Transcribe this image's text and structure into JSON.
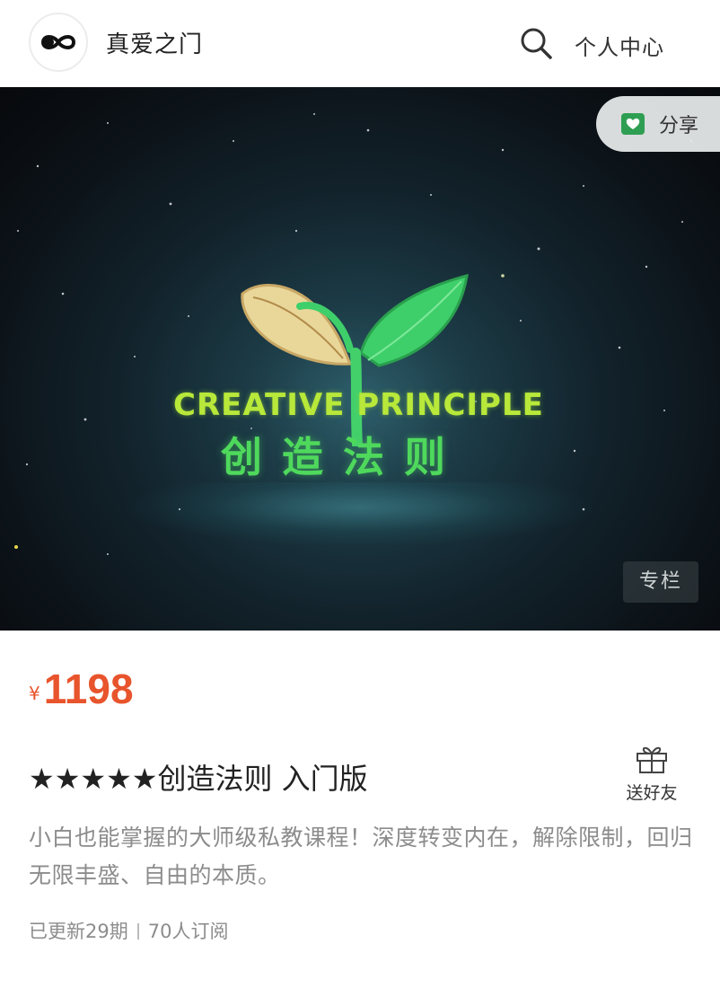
{
  "header": {
    "shop_name": "真爱之门",
    "personal_center": "个人中心",
    "logo_icon": "infinity-icon",
    "search_icon": "search-icon"
  },
  "banner": {
    "share_label": "分享",
    "share_icon": "wechat-share-icon",
    "tag": "专栏",
    "title_en": "CREATIVE PRINCIPLE",
    "title_cn": "创造法则"
  },
  "product": {
    "currency": "¥",
    "price": "1198",
    "title": "★★★★★创造法则 入门版",
    "gift_label": "送好友",
    "gift_icon": "gift-icon",
    "description": "小白也能掌握的大师级私教课程！深度转变内在，解除限制，回归无限丰盛、自由的本质。",
    "updated": "已更新29期",
    "subscribers": "70人订阅"
  },
  "colors": {
    "accent": "#e8542c",
    "muted_text": "#8c8c8c",
    "share_icon": "#2e9e52"
  }
}
